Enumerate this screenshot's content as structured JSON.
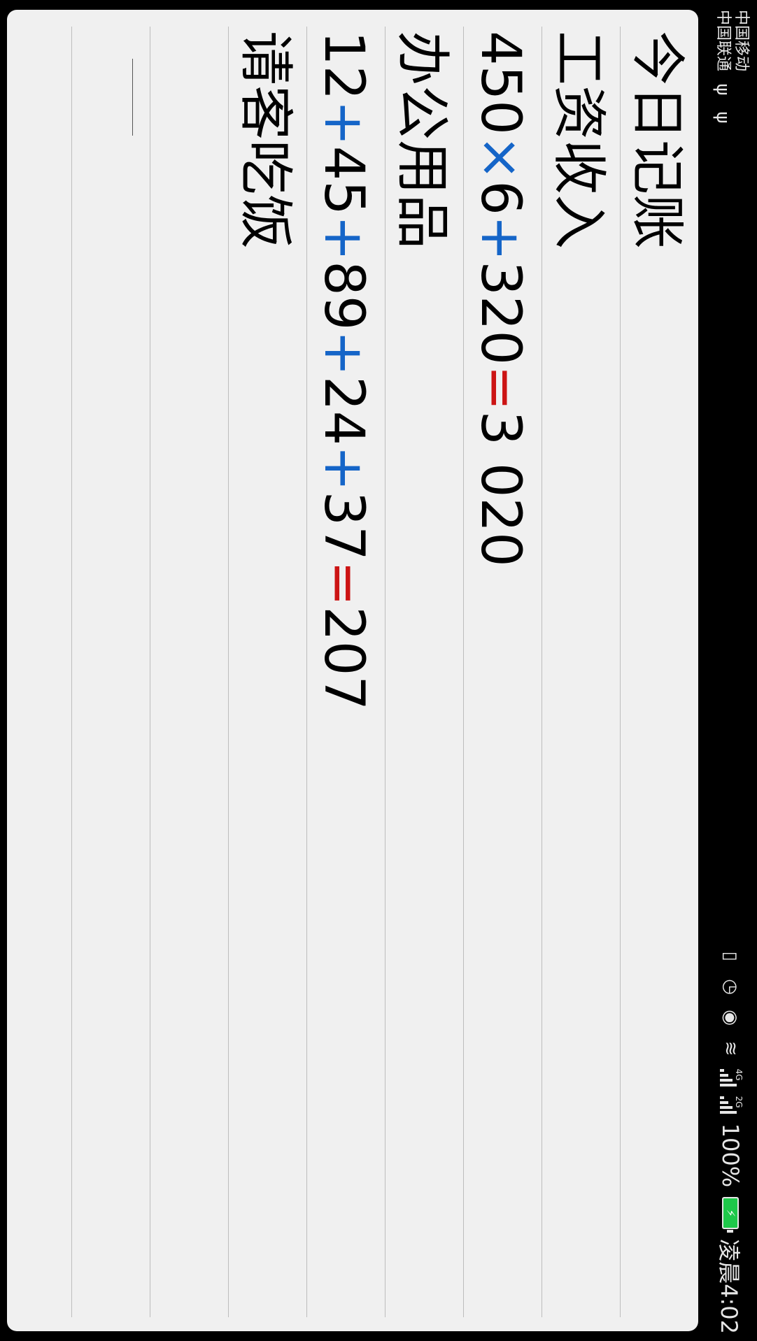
{
  "status_bar": {
    "carrier_1": "中国移动",
    "carrier_2": "中国联通",
    "network_1": "4G",
    "network_2": "2G",
    "battery_percent": "100%",
    "time": "凌晨4:02",
    "icons": [
      "usb-icon",
      "usb-icon",
      "vibrate-icon",
      "alarm-icon",
      "eye-icon",
      "wifi-icon",
      "signal-icon",
      "signal-icon",
      "battery-charging-icon"
    ],
    "battery_color": "#1ec84a"
  },
  "notebook": {
    "title": "今日记账",
    "lines": [
      {
        "text": "工资收入"
      },
      {
        "parts": [
          "450",
          "×",
          "6",
          "+",
          "320",
          "=",
          "3 020"
        ]
      },
      {
        "text": "办公用品"
      },
      {
        "parts": [
          "12",
          "+",
          "45",
          "+",
          "89",
          "+",
          "24",
          "+",
          "37",
          "=",
          "207"
        ]
      },
      {
        "text": "请客吃饭"
      }
    ],
    "colors": {
      "operator": "#1565c8",
      "equals": "#cc1414",
      "paper": "#f0f0f0",
      "rule": "#bdbdbd"
    }
  }
}
